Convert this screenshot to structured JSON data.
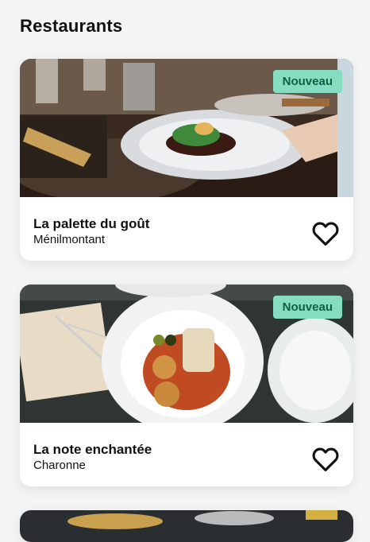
{
  "page": {
    "title": "Restaurants"
  },
  "restaurants": [
    {
      "name": "La palette du goût",
      "area": "Ménilmontant",
      "badge": "Nouveau",
      "photo": "restaurant-table-photo"
    },
    {
      "name": "La note enchantée",
      "area": "Charonne",
      "badge": "Nouveau",
      "photo": "plated-food-photo"
    },
    {
      "photo": "seafood-dish-photo"
    }
  ],
  "colors": {
    "badge_bg": "#86dcc0",
    "badge_text": "#0f5e46",
    "background": "#f4f4f4"
  },
  "icons": {
    "favorite": "heart-outline-icon"
  }
}
